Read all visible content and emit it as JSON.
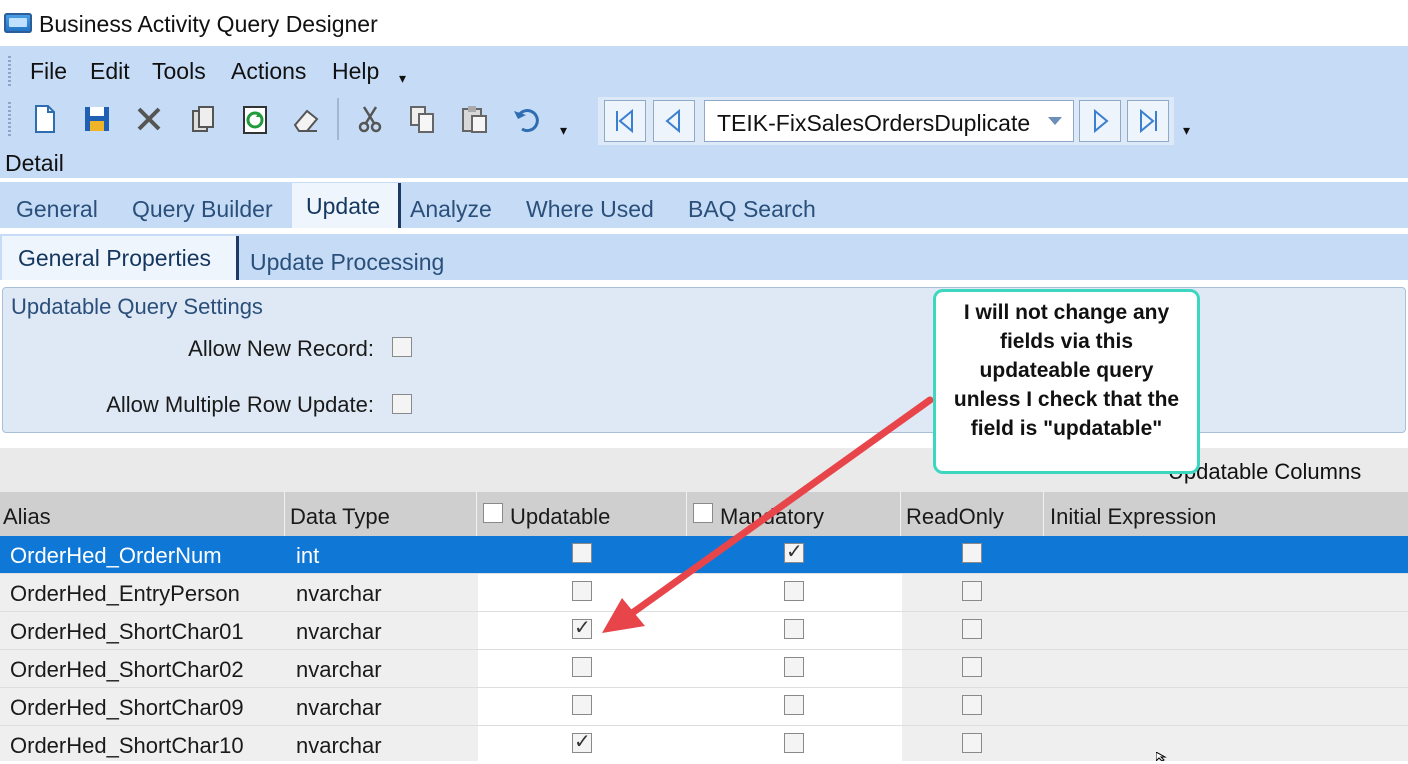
{
  "window": {
    "title": "Business Activity Query Designer"
  },
  "menu": {
    "items": [
      "File",
      "Edit",
      "Tools",
      "Actions",
      "Help"
    ]
  },
  "toolbar": {
    "query_name": "TEIK-FixSalesOrdersDuplicate",
    "icons": [
      "new-icon",
      "save-icon",
      "delete-icon",
      "attach-icon",
      "refresh-icon",
      "clear-icon",
      "cut-icon",
      "copy-icon",
      "paste-icon",
      "undo-icon"
    ]
  },
  "detail": {
    "label": "Detail"
  },
  "tabs": [
    "General",
    "Query Builder",
    "Update",
    "Analyze",
    "Where Used",
    "BAQ Search"
  ],
  "active_tab": "Update",
  "subtabs": [
    "General Properties",
    "Update  Processing"
  ],
  "active_subtab": "General Properties",
  "settings": {
    "title": "Updatable Query Settings",
    "allow_new_record_label": "Allow New Record:",
    "allow_new_record": false,
    "allow_multiple_row_update_label": "Allow Multiple Row Update:",
    "allow_multiple_row_update": false
  },
  "columns_section": {
    "label": "Updatable Columns"
  },
  "grid": {
    "headers": {
      "alias": "Alias",
      "data_type": "Data Type",
      "updatable": "Updatable",
      "mandatory": "Mandatory",
      "readonly": "ReadOnly",
      "initial_expression": "Initial Expression"
    },
    "rows": [
      {
        "alias": "OrderHed_OrderNum",
        "type": "int",
        "updatable": false,
        "mandatory": true,
        "readonly": false,
        "selected": true
      },
      {
        "alias": "OrderHed_EntryPerson",
        "type": "nvarchar",
        "updatable": false,
        "mandatory": false,
        "readonly": false
      },
      {
        "alias": "OrderHed_ShortChar01",
        "type": "nvarchar",
        "updatable": true,
        "mandatory": false,
        "readonly": false
      },
      {
        "alias": "OrderHed_ShortChar02",
        "type": "nvarchar",
        "updatable": false,
        "mandatory": false,
        "readonly": false
      },
      {
        "alias": "OrderHed_ShortChar09",
        "type": "nvarchar",
        "updatable": false,
        "mandatory": false,
        "readonly": false
      },
      {
        "alias": "OrderHed_ShortChar10",
        "type": "nvarchar",
        "updatable": true,
        "mandatory": false,
        "readonly": false
      }
    ]
  },
  "callout": {
    "text": "I will not change any fields via this updateable query unless I check that the field is \"updatable\""
  },
  "colors": {
    "accent": "#0f78d7",
    "ribbon": "#c6dcf6",
    "callout_border": "#3dd6c0",
    "arrow": "#e8454a"
  }
}
